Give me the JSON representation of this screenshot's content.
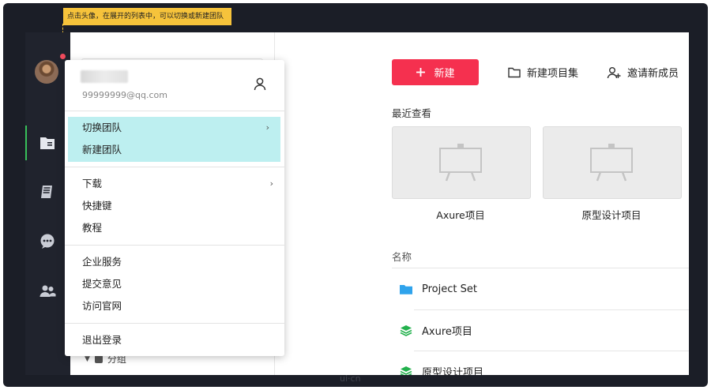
{
  "annotation": {
    "text": "点击头像，在展开的列表中，可以切换或新建团队"
  },
  "colors": {
    "accent": "#f5304f",
    "highlight": "#bdeff0",
    "rail_active": "#38c05a",
    "annotation": "#f6c33b"
  },
  "rail": {
    "items": [
      {
        "icon": "folder-icon"
      },
      {
        "icon": "book-icon"
      },
      {
        "icon": "chat-icon"
      },
      {
        "icon": "team-icon"
      }
    ]
  },
  "panel": {
    "group_label": "分组"
  },
  "toolbar": {
    "new_label": "新建",
    "new_set_label": "新建项目集",
    "invite_label": "邀请新成员"
  },
  "recent": {
    "title": "最近查看",
    "cards": [
      {
        "label": "Axure项目"
      },
      {
        "label": "原型设计项目"
      }
    ]
  },
  "list": {
    "header": "名称",
    "rows": [
      {
        "name": "Project Set",
        "icon": "folder-icon"
      },
      {
        "name": "Axure项目",
        "icon": "layers-icon"
      },
      {
        "name": "原型设计项目",
        "icon": "layers-icon"
      }
    ]
  },
  "dropdown": {
    "email": "99999999@qq.com",
    "team_items": [
      {
        "label": "切换团队",
        "has_submenu": true
      },
      {
        "label": "新建团队",
        "has_submenu": false
      }
    ],
    "help_items": [
      {
        "label": "下载",
        "has_submenu": true
      },
      {
        "label": "快捷键",
        "has_submenu": false
      },
      {
        "label": "教程",
        "has_submenu": false
      }
    ],
    "misc_items": [
      {
        "label": "企业服务"
      },
      {
        "label": "提交意见"
      },
      {
        "label": "访问官网"
      }
    ],
    "logout_label": "退出登录",
    "submenu_glyph": "›"
  },
  "watermark": {
    "text": "ui·cn"
  }
}
